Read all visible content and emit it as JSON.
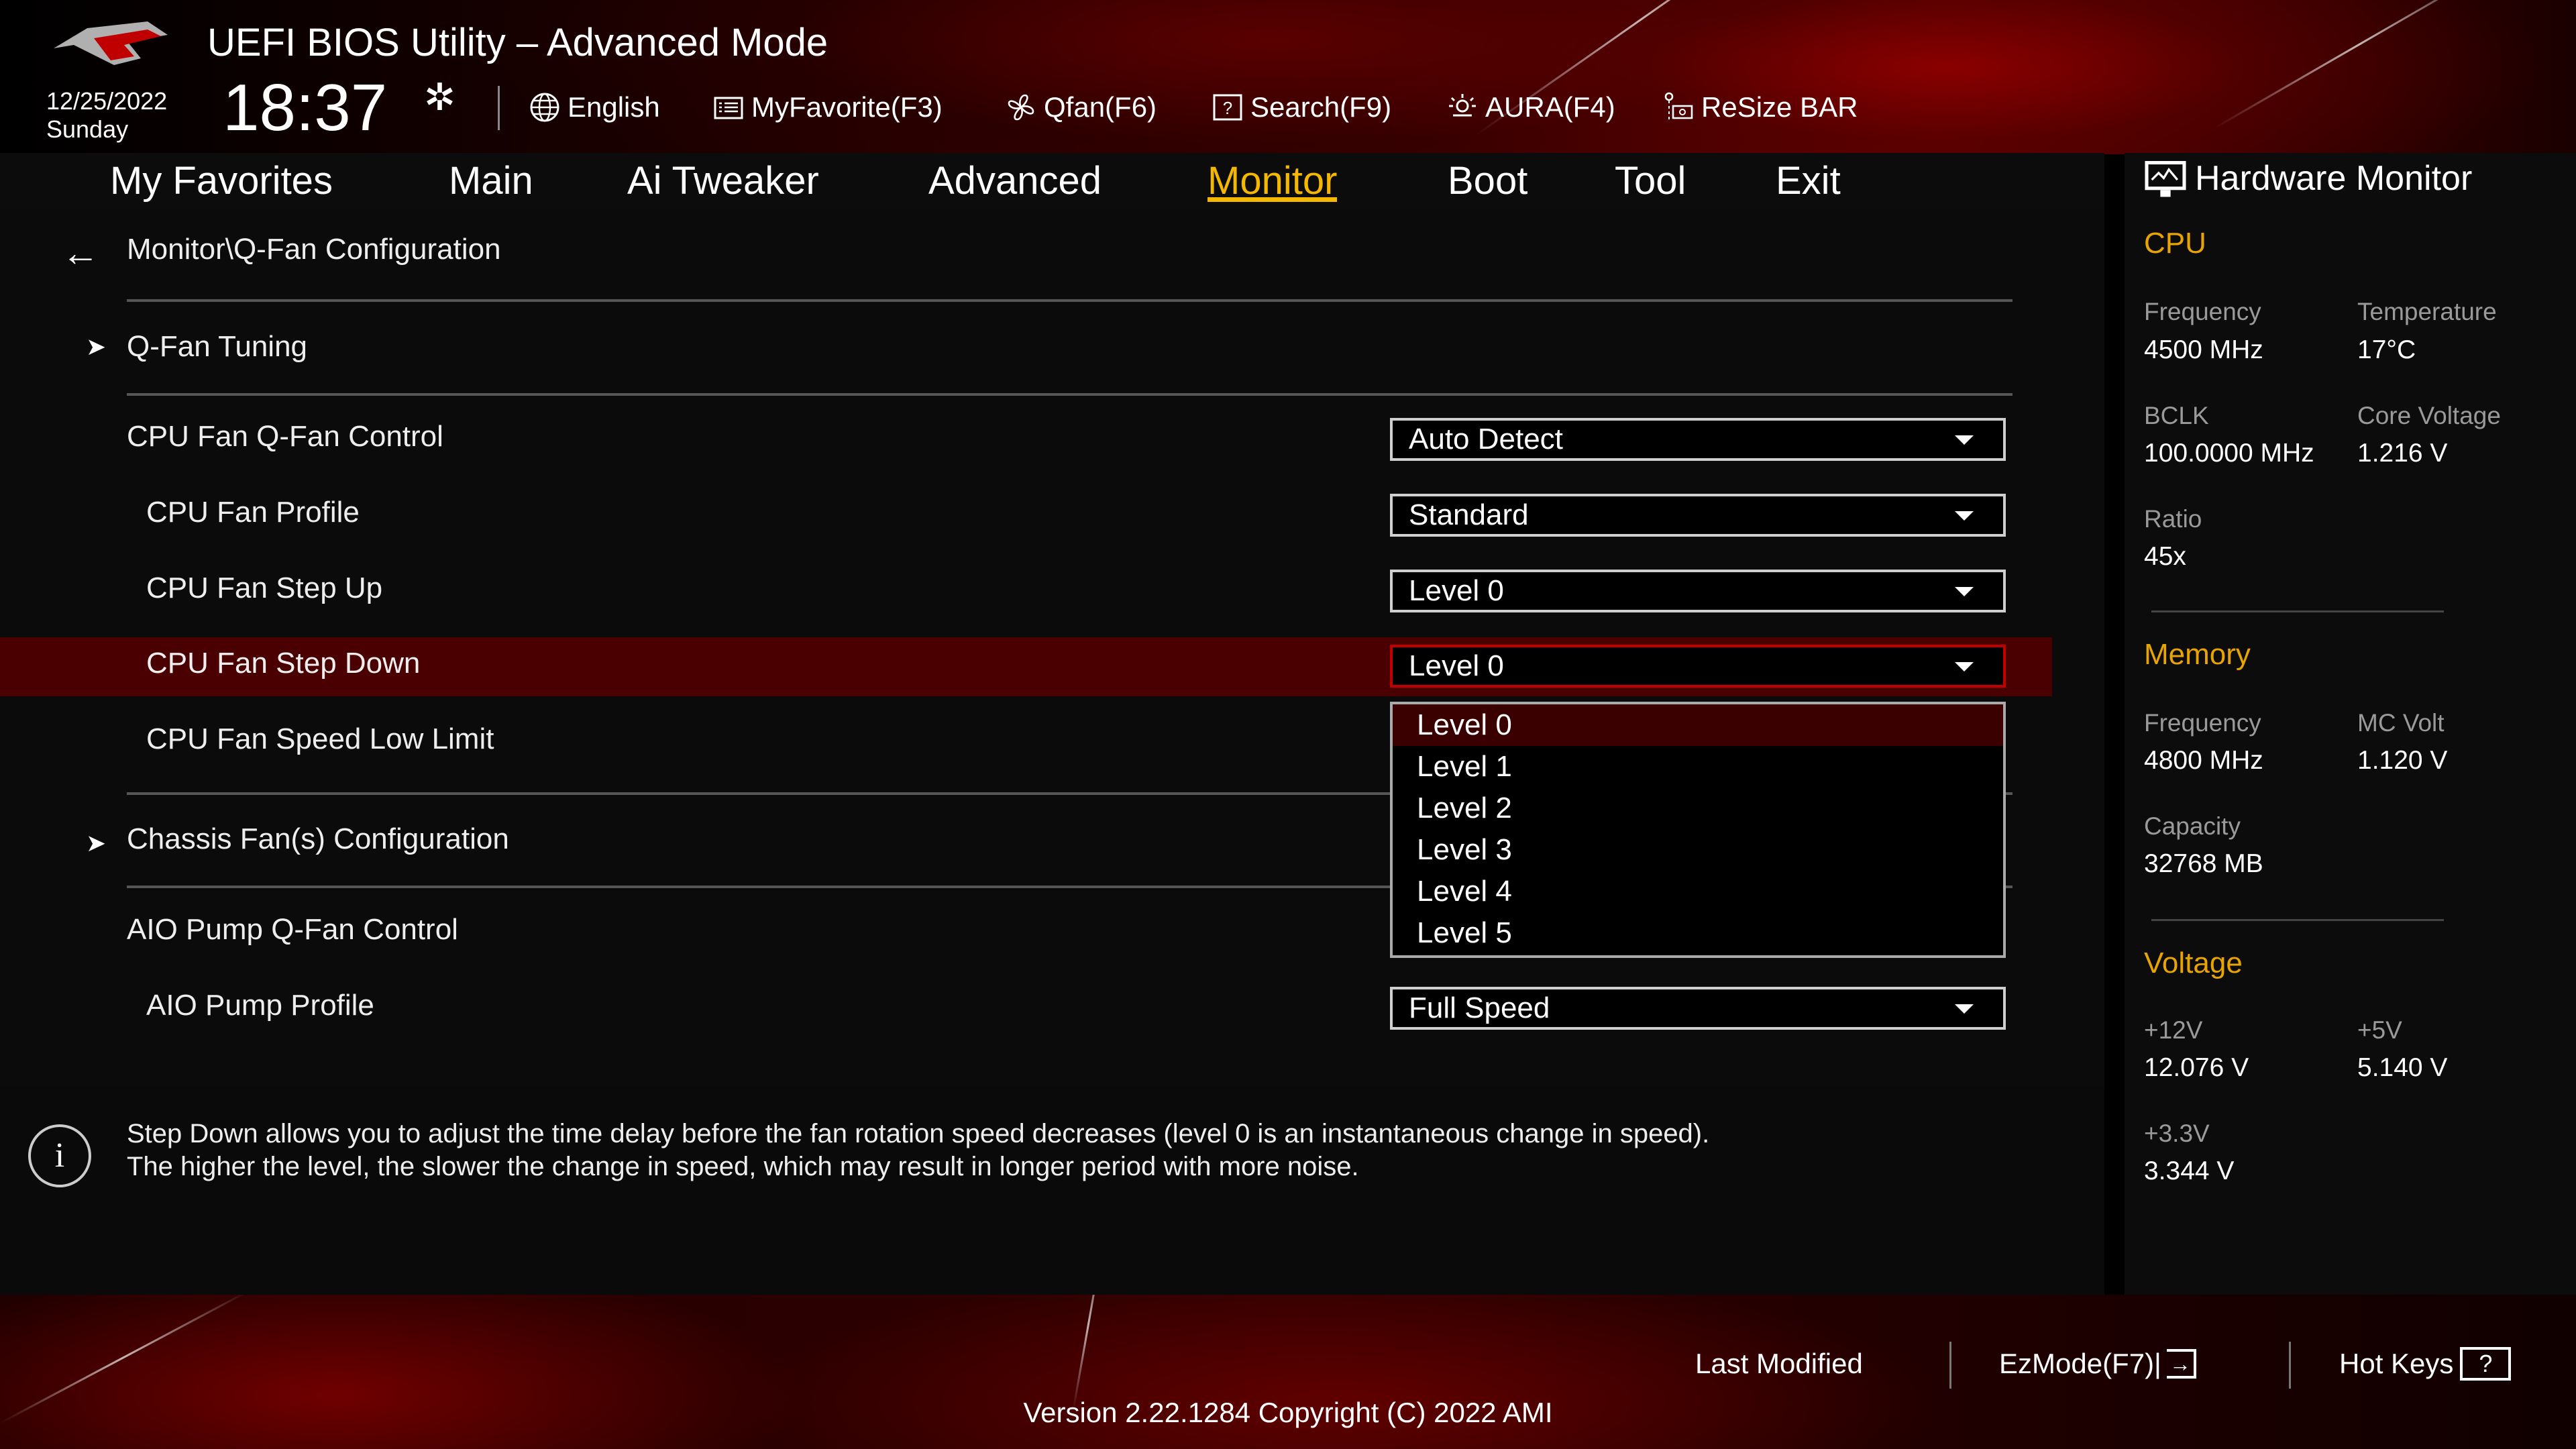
{
  "header": {
    "title": "UEFI BIOS Utility – Advanced Mode",
    "date": "12/25/2022",
    "day": "Sunday",
    "time": "18:37",
    "toolbar": [
      {
        "label": "English",
        "icon": "globe-icon"
      },
      {
        "label": "MyFavorite(F3)",
        "icon": "favorite-list-icon"
      },
      {
        "label": "Qfan(F6)",
        "icon": "fan-icon"
      },
      {
        "label": "Search(F9)",
        "icon": "question-box-icon"
      },
      {
        "label": "AURA(F4)",
        "icon": "aura-light-icon"
      },
      {
        "label": "ReSize BAR",
        "icon": "resize-bar-icon"
      }
    ]
  },
  "nav": {
    "tabs": [
      "My Favorites",
      "Main",
      "Ai Tweaker",
      "Advanced",
      "Monitor",
      "Boot",
      "Tool",
      "Exit"
    ],
    "active": "Monitor"
  },
  "main": {
    "breadcrumb": "Monitor\\Q-Fan Configuration",
    "qfan_tuning": "Q-Fan Tuning",
    "rows": [
      {
        "label": "CPU Fan Q-Fan Control",
        "value": "Auto Detect"
      },
      {
        "label": "CPU Fan Profile",
        "value": "Standard"
      },
      {
        "label": "CPU Fan Step Up",
        "value": "Level 0"
      },
      {
        "label": "CPU Fan Step Down",
        "value": "Level 0"
      },
      {
        "label": "CPU Fan Speed Low Limit"
      }
    ],
    "chassis": "Chassis Fan(s) Configuration",
    "aio_rows": [
      {
        "label": "AIO Pump Q-Fan Control"
      },
      {
        "label": "AIO Pump Profile",
        "value": "Full Speed"
      }
    ],
    "dropdown_options": [
      "Level 0",
      "Level 1",
      "Level 2",
      "Level 3",
      "Level 4",
      "Level 5"
    ],
    "dropdown_selected": "Level 0",
    "help": [
      "Step Down allows you to adjust the time delay before the fan rotation speed decreases (level 0 is an instantaneous change in speed).",
      "The higher the level, the slower the change in speed, which may result in longer period with more noise."
    ]
  },
  "hw": {
    "title": "Hardware Monitor",
    "cpu": {
      "heading": "CPU",
      "frequency_label": "Frequency",
      "frequency": "4500 MHz",
      "temperature_label": "Temperature",
      "temperature": "17°C",
      "bclk_label": "BCLK",
      "bclk": "100.0000 MHz",
      "core_voltage_label": "Core Voltage",
      "core_voltage": "1.216 V",
      "ratio_label": "Ratio",
      "ratio": "45x"
    },
    "memory": {
      "heading": "Memory",
      "frequency_label": "Frequency",
      "frequency": "4800 MHz",
      "mc_volt_label": "MC Volt",
      "mc_volt": "1.120 V",
      "capacity_label": "Capacity",
      "capacity": "32768 MB"
    },
    "voltage": {
      "heading": "Voltage",
      "v12_label": "+12V",
      "v12": "12.076 V",
      "v5_label": "+5V",
      "v5": "5.140 V",
      "v33_label": "+3.3V",
      "v33": "3.344 V"
    }
  },
  "footer": {
    "last_modified": "Last Modified",
    "ezmode": "EzMode(F7)|",
    "hotkeys": "Hot Keys",
    "hotkeys_icon": "?",
    "version": "Version 2.22.1284 Copyright (C) 2022 AMI"
  },
  "colors": {
    "accent": "#f5b800",
    "highlight": "#4a0000",
    "option_selected": "#3a0000"
  }
}
